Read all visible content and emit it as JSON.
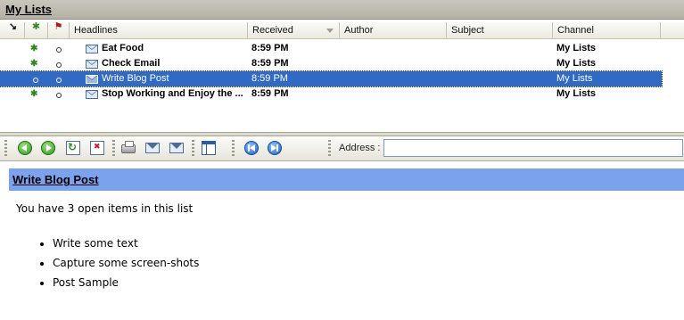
{
  "title": "My Lists",
  "list": {
    "columns": {
      "headlines": "Headlines",
      "received": "Received",
      "author": "Author",
      "subject": "Subject",
      "channel": "Channel"
    },
    "rows": [
      {
        "headline": "Eat Food",
        "received": "8:59 PM",
        "author": "",
        "subject": "",
        "channel": "My Lists",
        "unread": true,
        "selected": false
      },
      {
        "headline": "Check Email",
        "received": "8:59 PM",
        "author": "",
        "subject": "",
        "channel": "My Lists",
        "unread": true,
        "selected": false
      },
      {
        "headline": "Write Blog Post",
        "received": "8:59 PM",
        "author": "",
        "subject": "",
        "channel": "My Lists",
        "unread": false,
        "selected": true
      },
      {
        "headline": "Stop Working and Enjoy the ...",
        "received": "8:59 PM",
        "author": "",
        "subject": "",
        "channel": "My Lists",
        "unread": true,
        "selected": false
      }
    ]
  },
  "toolbar": {
    "address_label": "Address :",
    "address_value": ""
  },
  "preview": {
    "title": "Write Blog Post",
    "summary": "You have 3 open items in this list",
    "items": [
      "Write some text",
      "Capture some screen-shots",
      "Post Sample"
    ]
  },
  "colors": {
    "selection": "#316ac5",
    "preview_header": "#7ba2ec"
  }
}
